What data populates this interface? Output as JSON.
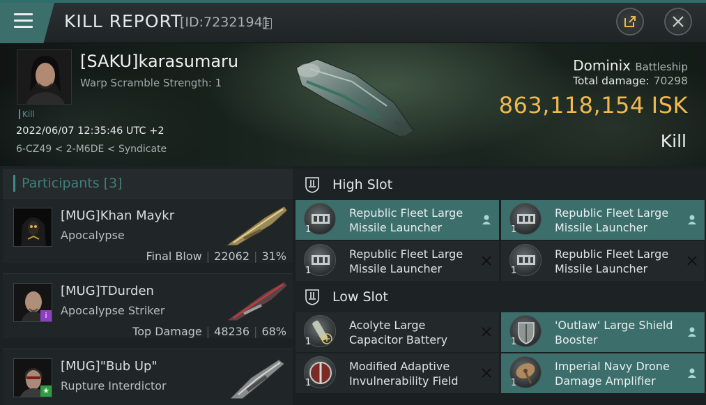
{
  "header": {
    "title": "KILL REPORT",
    "report_id": "[ID:7232194]"
  },
  "victim": {
    "pilot": "[SAKU]karasumaru",
    "scramble": "Warp Scramble Strength: 1",
    "kill_tag": "Kill",
    "timestamp": "2022/06/07 12:35:46 UTC +2",
    "location": "6-CZ49 < 2-M6DE < Syndicate",
    "ship": "Dominix",
    "ship_class": "Battleship",
    "total_damage_label": "Total damage:",
    "total_damage": "70298",
    "isk_value": "863,118,154",
    "isk_unit": "ISK",
    "result": "Kill"
  },
  "participants": {
    "title": "Participants",
    "count": "[3]",
    "rows": [
      {
        "name": "[MUG]Khan Maykr",
        "ship": "Apocalypse",
        "role": "Final Blow",
        "damage": "22062",
        "percent": "31%"
      },
      {
        "name": "[MUG]TDurden",
        "ship": "Apocalypse Striker",
        "role": "Top Damage",
        "damage": "48236",
        "percent": "68%"
      },
      {
        "name": "[MUG]\"Bub Up\"",
        "ship": "Rupture Interdictor"
      }
    ]
  },
  "fitting": {
    "high_slot_title": "High Slot",
    "low_slot_title": "Low Slot",
    "high": [
      {
        "name": "Republic Fleet Large Missile Launcher",
        "qty": "1",
        "status": "pilot-icon"
      },
      {
        "name": "Republic Fleet Large Missile Launcher",
        "qty": "1",
        "status": "pilot-icon"
      },
      {
        "name": "Republic Fleet Large Missile Launcher",
        "qty": "1",
        "status": "destroyed-icon"
      },
      {
        "name": "Republic Fleet Large Missile Launcher",
        "qty": "1",
        "status": "destroyed-icon"
      }
    ],
    "low": [
      {
        "name": "Acolyte Large Capacitor Battery",
        "qty": "1",
        "status": "destroyed-icon"
      },
      {
        "name": "'Outlaw' Large Shield Booster",
        "qty": "1",
        "status": "pilot-icon"
      },
      {
        "name": "Modified Adaptive Invulnerability Field",
        "qty": "1",
        "status": "destroyed-icon"
      },
      {
        "name": "Imperial Navy Drone Damage Amplifier",
        "qty": "1",
        "status": "pilot-icon"
      }
    ]
  },
  "colors": {
    "accent": "#3c6e6c",
    "isk": "#f0b94f",
    "participants_title": "#3f7f7b"
  }
}
